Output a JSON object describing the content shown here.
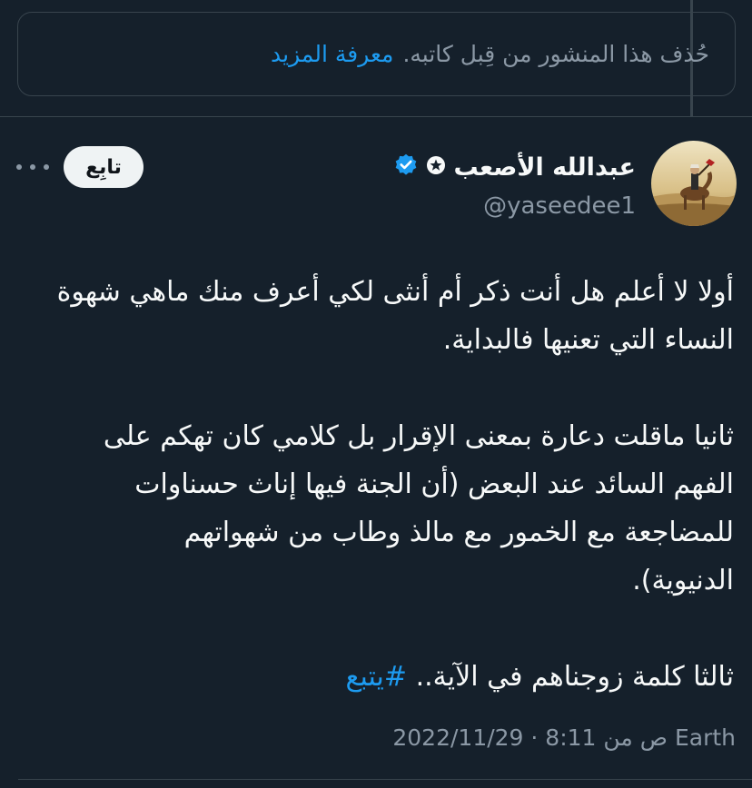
{
  "deleted_notice": {
    "text": "حُذف هذا المنشور من قِبل كاتبه.",
    "learn_more": "معرفة المزيد"
  },
  "author": {
    "display_name": "عبدالله الأصعب",
    "handle": "@yaseedee1",
    "badge_star_icon": "star-circle-icon",
    "verified_icon": "verified-badge-icon"
  },
  "actions": {
    "follow_label": "تابِع",
    "more_icon": "more-horizontal-icon"
  },
  "tweet": {
    "paragraph1_line1": "أولا لا أعلم هل أنت ذكر أم أنثى لكي أعرف منك ماهي شهوة",
    "paragraph1_line2": "النساء التي تعنيها فالبداية.",
    "paragraph2_line1": "ثانيا ماقلت دعارة بمعنى الإقرار بل كلامي كان تهكم على",
    "paragraph2_line2": "الفهم السائد عند البعض (أن الجنة فيها إناث حسناوات",
    "paragraph2_line3": "للمضاجعة مع الخمور مع مالذ وطاب من شهواتهم",
    "paragraph2_line4": "الدنيوية).",
    "paragraph3_text": "ثالثا كلمة زوجناهم في الآية.. ",
    "hashtag": "#يتبع"
  },
  "meta": {
    "timestamp": "2022/11/29 · 8:11 ص من Earth"
  },
  "colors": {
    "background": "#15202b",
    "accent": "#1d9bf0",
    "text": "#f7f9f9",
    "muted": "#8b98a5",
    "border": "#38444d"
  }
}
